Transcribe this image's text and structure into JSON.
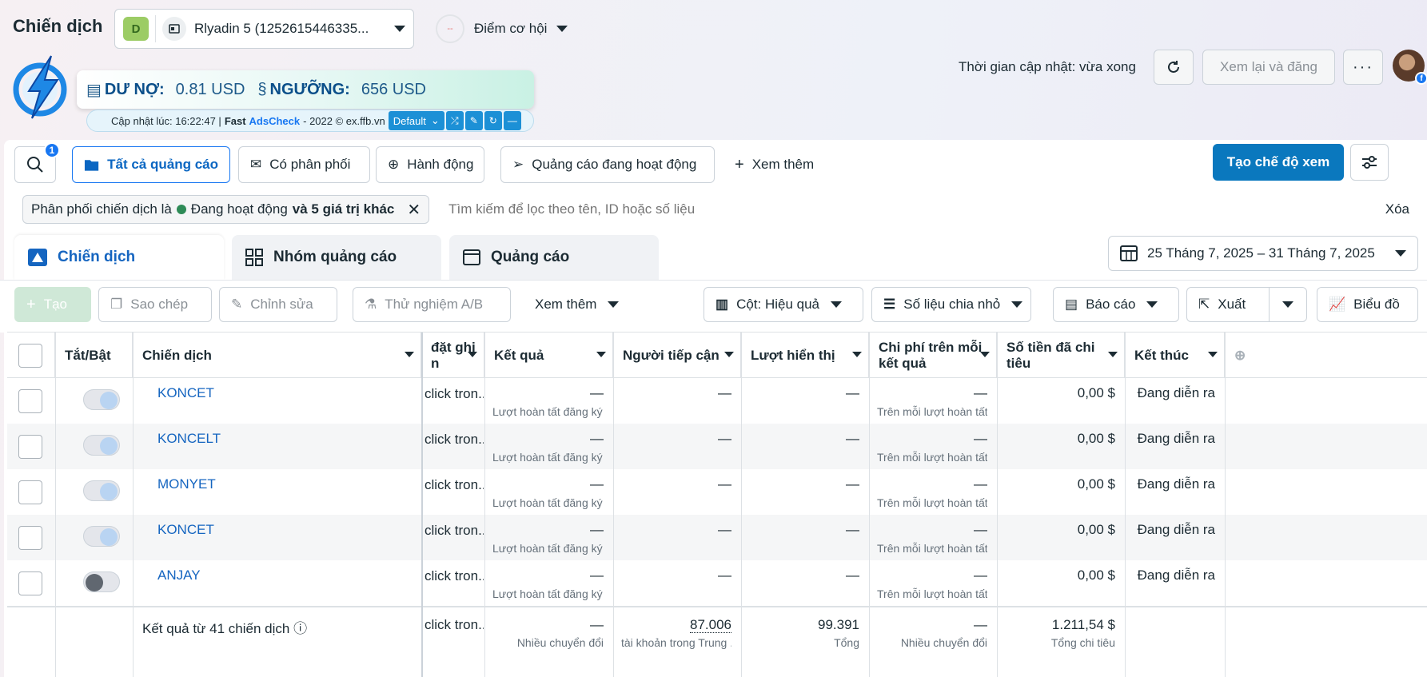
{
  "header": {
    "title": "Chiến dịch",
    "account_badge": "D",
    "account_name": "Rlyadin 5 (1252615446335...",
    "opp_dash": "--",
    "opp_label": "Điểm cơ hội",
    "update_time": "Thời gian cập nhật: vừa xong",
    "review_button": "Xem lại và đăng",
    "more_button": "···"
  },
  "extension": {
    "debt_label": "DƯ NỢ:",
    "debt_value": "0.81 USD",
    "threshold_label": "NGƯỠNG:",
    "threshold_value": "656 USD",
    "updated": "Cập nhật lúc: 16:22:47 |",
    "fast": "Fast",
    "adscheck": "AdsCheck",
    "copyright": "- 2022 © ex.ffb.vn",
    "dropdown": "Default"
  },
  "toolbar": {
    "search_count": "1",
    "all_ads": "Tất cả quảng cáo",
    "delivery": "Có phân phối",
    "actions": "Hành động",
    "active_ads": "Quảng cáo đang hoạt động",
    "see_more": "Xem thêm",
    "create_view": "Tạo chế độ xem"
  },
  "filter": {
    "prefix": "Phân phối chiến dịch là",
    "status": "Đang hoạt động",
    "suffix": "và 5 giá trị khác",
    "search_placeholder": "Tìm kiếm để lọc theo tên, ID hoặc số liệu",
    "clear": "Xóa"
  },
  "tabs": [
    {
      "label": "Chiến dịch"
    },
    {
      "label": "Nhóm quảng cáo"
    },
    {
      "label": "Quảng cáo"
    }
  ],
  "date_range": "25 Tháng 7, 2025 – 31 Tháng 7, 2025",
  "actions": {
    "create": "Tạo",
    "copy": "Sao chép",
    "edit": "Chỉnh sửa",
    "ab_test": "Thử nghiệm A/B",
    "see_more": "Xem thêm",
    "columns": "Cột: Hiệu quả",
    "breakdown": "Số liệu chia nhỏ",
    "reports": "Báo cáo",
    "export": "Xuất",
    "chart": "Biểu đồ"
  },
  "table": {
    "headers": {
      "toggle": "Tắt/Bật",
      "campaign": "Chiến dịch",
      "attribution_line1": "đặt ghi",
      "attribution_line2": "n",
      "results": "Kết quả",
      "reach": "Người tiếp cận",
      "impressions": "Lượt hiển thị",
      "cpr_line1": "Chi phí trên mỗi",
      "cpr_line2": "kết quả",
      "spent_line1": "Số tiền đã chi",
      "spent_line2": "tiêu",
      "end": "Kết thúc"
    },
    "rows": [
      {
        "name": "KONCET",
        "toggle": "on",
        "attribution": "click tron...",
        "result": "—",
        "result_sub": "Lượt hoàn tất đăng ký ...",
        "reach": "—",
        "impressions": "—",
        "cpr": "—",
        "cpr_sub": "Trên mỗi lượt hoàn tất...",
        "spent": "0,00 $",
        "end": "Đang diễn ra"
      },
      {
        "name": "KONCELT",
        "toggle": "on",
        "attribution": "click tron...",
        "result": "—",
        "result_sub": "Lượt hoàn tất đăng ký ...",
        "reach": "—",
        "impressions": "—",
        "cpr": "—",
        "cpr_sub": "Trên mỗi lượt hoàn tất...",
        "spent": "0,00 $",
        "end": "Đang diễn ra"
      },
      {
        "name": "MONYET",
        "toggle": "on",
        "attribution": "click tron...",
        "result": "—",
        "result_sub": "Lượt hoàn tất đăng ký ...",
        "reach": "—",
        "impressions": "—",
        "cpr": "—",
        "cpr_sub": "Trên mỗi lượt hoàn tất...",
        "spent": "0,00 $",
        "end": "Đang diễn ra"
      },
      {
        "name": "KONCET",
        "toggle": "on",
        "attribution": "click tron...",
        "result": "—",
        "result_sub": "Lượt hoàn tất đăng ký ...",
        "reach": "—",
        "impressions": "—",
        "cpr": "—",
        "cpr_sub": "Trên mỗi lượt hoàn tất...",
        "spent": "0,00 $",
        "end": "Đang diễn ra"
      },
      {
        "name": "ANJAY",
        "toggle": "off",
        "attribution": "click tron...",
        "result": "—",
        "result_sub": "Lượt hoàn tất đăng ký ...",
        "reach": "—",
        "impressions": "—",
        "cpr": "—",
        "cpr_sub": "Trên mỗi lượt hoàn tất...",
        "spent": "0,00 $",
        "end": "Đang diễn ra"
      }
    ],
    "footer": {
      "label": "Kết quả từ 41 chiến dịch",
      "attribution": "click tron...",
      "result": "—",
      "result_sub": "Nhiều chuyển đổi",
      "reach": "87.006",
      "reach_sub": "tài khoản trong Trung ...",
      "impressions": "99.391",
      "impressions_sub": "Tổng",
      "cpr": "—",
      "cpr_sub": "Nhiều chuyển đổi",
      "spent": "1.211,54 $",
      "spent_sub": "Tổng chi tiêu"
    }
  },
  "colors": {
    "primary": "#0a78be",
    "link": "#1565c0",
    "active_dot": "#2e8b57"
  }
}
